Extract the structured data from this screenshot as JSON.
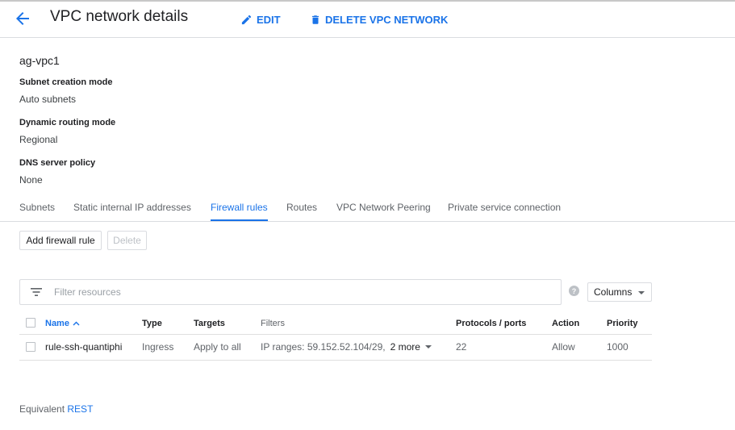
{
  "header": {
    "title": "VPC network details",
    "edit_label": "EDIT",
    "delete_label": "DELETE VPC NETWORK",
    "back_icon": "arrow-back-icon",
    "edit_icon": "pencil-icon",
    "delete_icon": "trash-icon"
  },
  "network": {
    "name": "ag-vpc1",
    "properties": [
      {
        "label": "Subnet creation mode",
        "value": "Auto subnets"
      },
      {
        "label": "Dynamic routing mode",
        "value": "Regional"
      },
      {
        "label": "DNS server policy",
        "value": "None"
      }
    ]
  },
  "tabs": [
    {
      "label": "Subnets",
      "active": false
    },
    {
      "label": "Static internal IP addresses",
      "active": false
    },
    {
      "label": "Firewall rules",
      "active": true
    },
    {
      "label": "Routes",
      "active": false
    },
    {
      "label": "VPC Network Peering",
      "active": false
    },
    {
      "label": "Private service connection",
      "active": false
    }
  ],
  "actions": {
    "add_label": "Add firewall rule",
    "delete_label": "Delete"
  },
  "filter": {
    "placeholder": "Filter resources",
    "help": "?",
    "columns_label": "Columns"
  },
  "table": {
    "headers": [
      "Name",
      "Type",
      "Targets",
      "Filters",
      "Protocols / ports",
      "Action",
      "Priority"
    ],
    "rows": [
      {
        "name": "rule-ssh-quantiphi",
        "type": "Ingress",
        "targets": "Apply to all",
        "filters": "IP ranges: 59.152.52.104/29,",
        "filters_more": "2 more",
        "protocols": "22",
        "action": "Allow",
        "priority": "1000"
      }
    ]
  },
  "footer": {
    "prefix": "Equivalent",
    "link": "REST"
  },
  "colors": {
    "accent": "#1a73e8",
    "text": "#202124",
    "muted": "#5f6368",
    "border": "#dadce0"
  }
}
